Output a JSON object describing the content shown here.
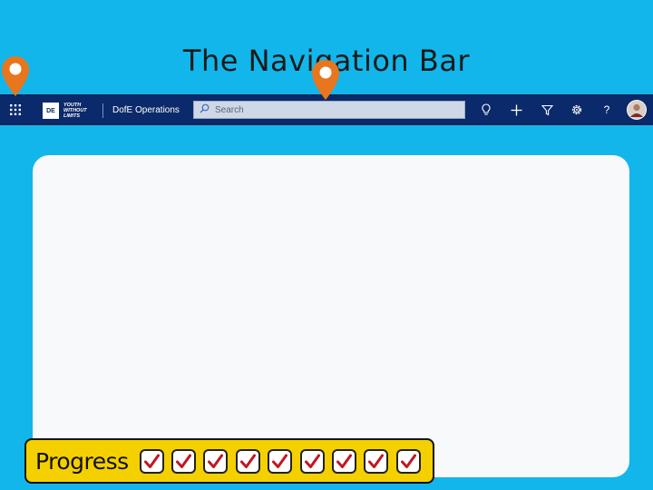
{
  "slide": {
    "title": "The Navigation Bar"
  },
  "navbar": {
    "logo_badge": "DE",
    "logo_lines": [
      "YOUTH",
      "WITHOUT",
      "LIMITS"
    ],
    "app_name": "DofE Operations",
    "search_placeholder": "Search",
    "icons": [
      "app-launcher-icon",
      "lightbulb-icon",
      "plus-icon",
      "filter-icon",
      "gear-icon",
      "help-icon",
      "user-avatar"
    ],
    "help_glyph": "?",
    "colors": {
      "bar": "#0b2a6b",
      "search_bg": "#cfd8e6"
    }
  },
  "markers": {
    "color": "#e8761e",
    "count": 2
  },
  "progress": {
    "label": "Progress",
    "steps_total": 9,
    "steps_completed": 9,
    "colors": {
      "box": "#f5d000",
      "check": "#c0181e"
    }
  },
  "colors": {
    "background": "#12b6ea",
    "panel": "#f8f9fb"
  }
}
